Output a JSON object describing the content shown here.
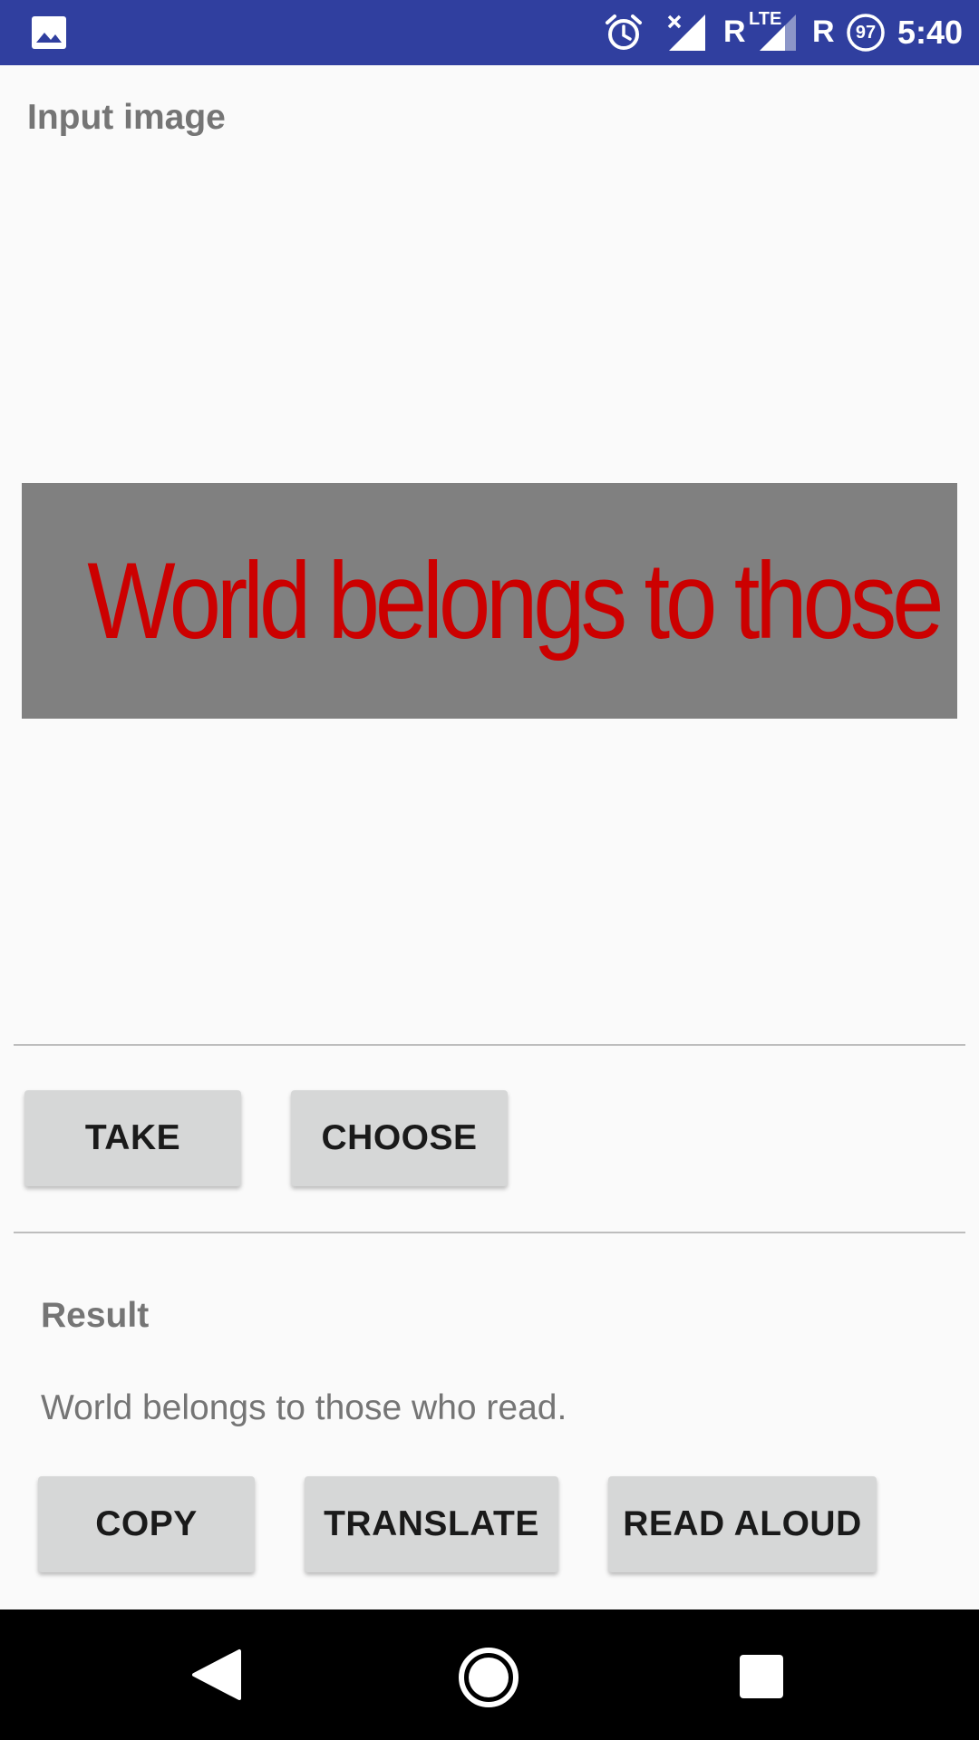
{
  "status_bar": {
    "notification_icon": "gallery-icon",
    "icons": [
      "alarm-icon",
      "signal-off-icon",
      "signal-lte-icon",
      "battery-saver-icon"
    ],
    "roaming_1": "R",
    "lte": "LTE",
    "roaming_2": "R",
    "battery": "97",
    "time": "5:40",
    "color": "#303f9f"
  },
  "input": {
    "label": "Input image",
    "image_text": "World belongs to those who read.",
    "image_bg": "#808080",
    "image_text_color": "#cc0000"
  },
  "actions": {
    "take": "TAKE",
    "choose": "CHOOSE"
  },
  "result": {
    "label": "Result",
    "text": "World belongs to those who read.",
    "copy": "COPY",
    "translate": "TRANSLATE",
    "read_aloud": "READ ALOUD"
  },
  "nav_bar": {
    "icons": [
      "back-icon",
      "home-icon",
      "recents-icon"
    ]
  }
}
